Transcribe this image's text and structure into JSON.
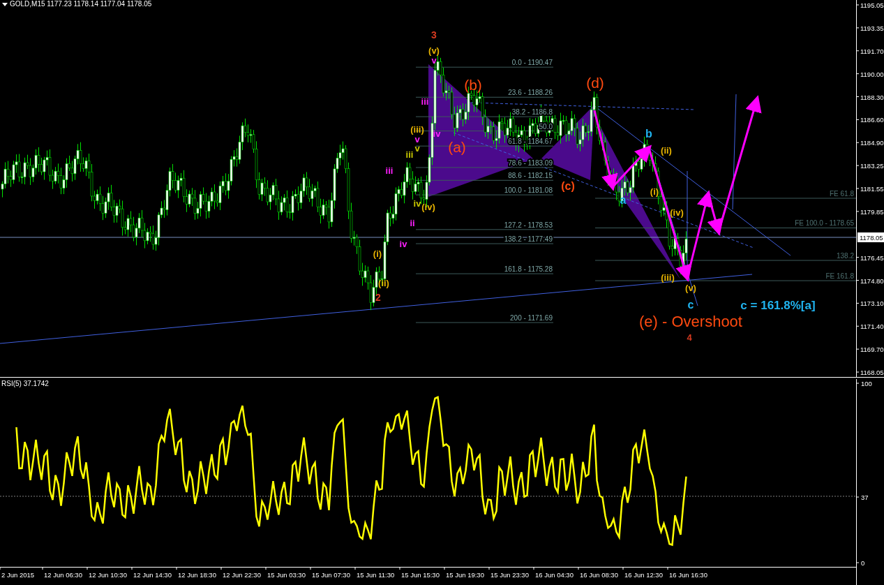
{
  "header": {
    "symbol_quote": "GOLD,M15  1177.23 1178.14 1177.04 1178.05"
  },
  "price_axis": {
    "ticks": [
      "1195.05",
      "1193.35",
      "1191.70",
      "1190.00",
      "1188.30",
      "1186.60",
      "1184.90",
      "1183.25",
      "1181.55",
      "1179.85",
      "1176.45",
      "1174.80",
      "1173.10",
      "1171.40",
      "1169.70",
      "1168.05"
    ],
    "current_price": "1178.05"
  },
  "fib_levels": [
    {
      "label": "0.0 - 1190.47"
    },
    {
      "label": "23.6  - 1188.26"
    },
    {
      "label": "38.2 - 1186.8"
    },
    {
      "label": "50.0"
    },
    {
      "label": "61.8 - 1184.67"
    },
    {
      "label": "78.6 - 1183.09"
    },
    {
      "label": "88.6 - 1182.15"
    },
    {
      "label": "100.0 - 1181.08"
    },
    {
      "label": "127.2 - 1178.53"
    },
    {
      "label": "138.2 - 1177.49"
    },
    {
      "label": "161.8 - 1175.28"
    },
    {
      "label": "200 - 1171.69"
    }
  ],
  "fe_levels": [
    {
      "label": "FE 61.8"
    },
    {
      "label": "FE 100.0 - 1178.65"
    },
    {
      "label": "138.2"
    },
    {
      "label": "FE 161.8"
    }
  ],
  "wave_labels": [
    {
      "text": "3",
      "color": "#d83a20"
    },
    {
      "text": "(v)",
      "color": "#e8b400"
    },
    {
      "text": "v",
      "color": "#ff20ff"
    },
    {
      "text": "(b)",
      "color": "#ff4a10"
    },
    {
      "text": "iii",
      "color": "#ff20ff"
    },
    {
      "text": "(iii)",
      "color": "#e8b400"
    },
    {
      "text": "v",
      "color": "#ff20ff"
    },
    {
      "text": "v",
      "color": "#c8c800"
    },
    {
      "text": "iii",
      "color": "#c8c800"
    },
    {
      "text": "iii",
      "color": "#ff20ff"
    },
    {
      "text": "iv",
      "color": "#ff20ff"
    },
    {
      "text": "(a)",
      "color": "#ff4a10"
    },
    {
      "text": "iv",
      "color": "#c8c800"
    },
    {
      "text": "(iv)",
      "color": "#e8b400"
    },
    {
      "text": "ii",
      "color": "#ff20ff"
    },
    {
      "text": "iv",
      "color": "#ff20ff"
    },
    {
      "text": "(i)",
      "color": "#e8b400"
    },
    {
      "text": "(ii)",
      "color": "#e8b400"
    },
    {
      "text": "2",
      "color": "#d83a20"
    },
    {
      "text": "(c)",
      "color": "#ff4a10"
    },
    {
      "text": "(d)",
      "color": "#ff4a10"
    },
    {
      "text": "b",
      "color": "#20b4f0"
    },
    {
      "text": "a",
      "color": "#20b4f0"
    },
    {
      "text": "(ii)",
      "color": "#e8b400"
    },
    {
      "text": "(i)",
      "color": "#e8b400"
    },
    {
      "text": "(iv)",
      "color": "#e8b400"
    },
    {
      "text": "(iii)",
      "color": "#e8b400"
    },
    {
      "text": "(v)",
      "color": "#e8b400"
    },
    {
      "text": "c",
      "color": "#20b4f0"
    },
    {
      "text": "c = 161.8%[a]",
      "color": "#20b4f0"
    },
    {
      "text": "(e) - Overshoot",
      "color": "#ff4a10"
    },
    {
      "text": "4",
      "color": "#d83a20"
    }
  ],
  "rsi": {
    "title": "RSI(5) 37.1742",
    "axis_labels": [
      "100",
      "37",
      "0"
    ]
  },
  "time_axis": {
    "labels": [
      "2 Jun 2015",
      "12 Jun 06:30",
      "12 Jun 10:30",
      "12 Jun 14:30",
      "12 Jun 18:30",
      "12 Jun 22:30",
      "15 Jun 03:30",
      "15 Jun 07:30",
      "15 Jun 11:30",
      "15 Jun 15:30",
      "15 Jun 19:30",
      "15 Jun 23:30",
      "16 Jun 04:30",
      "16 Jun 08:30",
      "16 Jun 12:30",
      "16 Jun 16:30"
    ]
  }
}
